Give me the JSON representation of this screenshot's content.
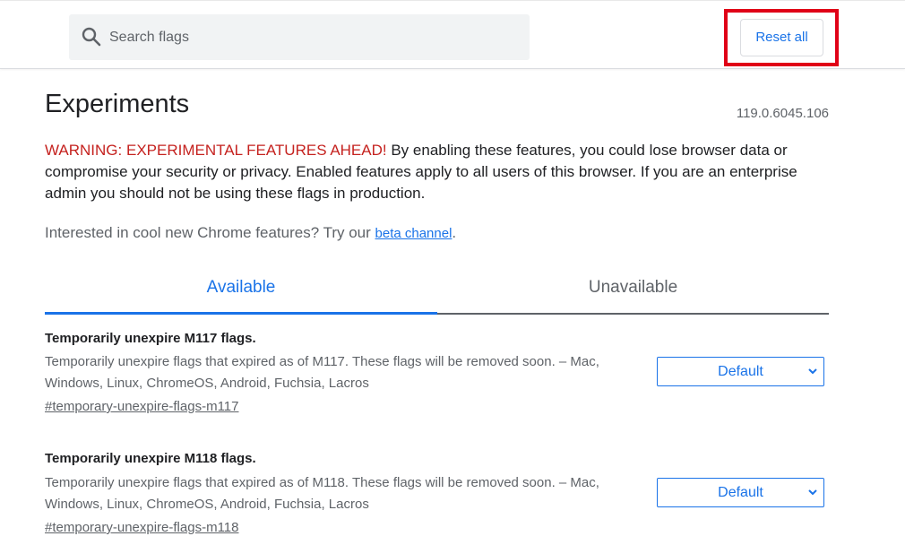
{
  "header": {
    "search_placeholder": "Search flags",
    "reset_label": "Reset all"
  },
  "page": {
    "title": "Experiments",
    "version": "119.0.6045.106",
    "warning_prefix": "WARNING: EXPERIMENTAL FEATURES AHEAD!",
    "warning_text": " By enabling these features, you could lose browser data or compromise your security or privacy. Enabled features apply to all users of this browser. If you are an enterprise admin you should not be using these flags in production.",
    "beta_prefix": "Interested in cool new Chrome features? Try our ",
    "beta_link": "beta channel",
    "beta_suffix": "."
  },
  "tabs": [
    {
      "label": "Available",
      "active": true
    },
    {
      "label": "Unavailable",
      "active": false
    }
  ],
  "flags": [
    {
      "title": "Temporarily unexpire M117 flags.",
      "description": "Temporarily unexpire flags that expired as of M117. These flags will be removed soon. – Mac, Windows, Linux, ChromeOS, Android, Fuchsia, Lacros",
      "link": "#temporary-unexpire-flags-m117",
      "value": "Default"
    },
    {
      "title": "Temporarily unexpire M118 flags.",
      "description": "Temporarily unexpire flags that expired as of M118. These flags will be removed soon. – Mac, Windows, Linux, ChromeOS, Android, Fuchsia, Lacros",
      "link": "#temporary-unexpire-flags-m118",
      "value": "Default"
    }
  ],
  "colors": {
    "accent": "#1a73e8",
    "warning": "#c5221f",
    "highlight": "#e00017"
  }
}
